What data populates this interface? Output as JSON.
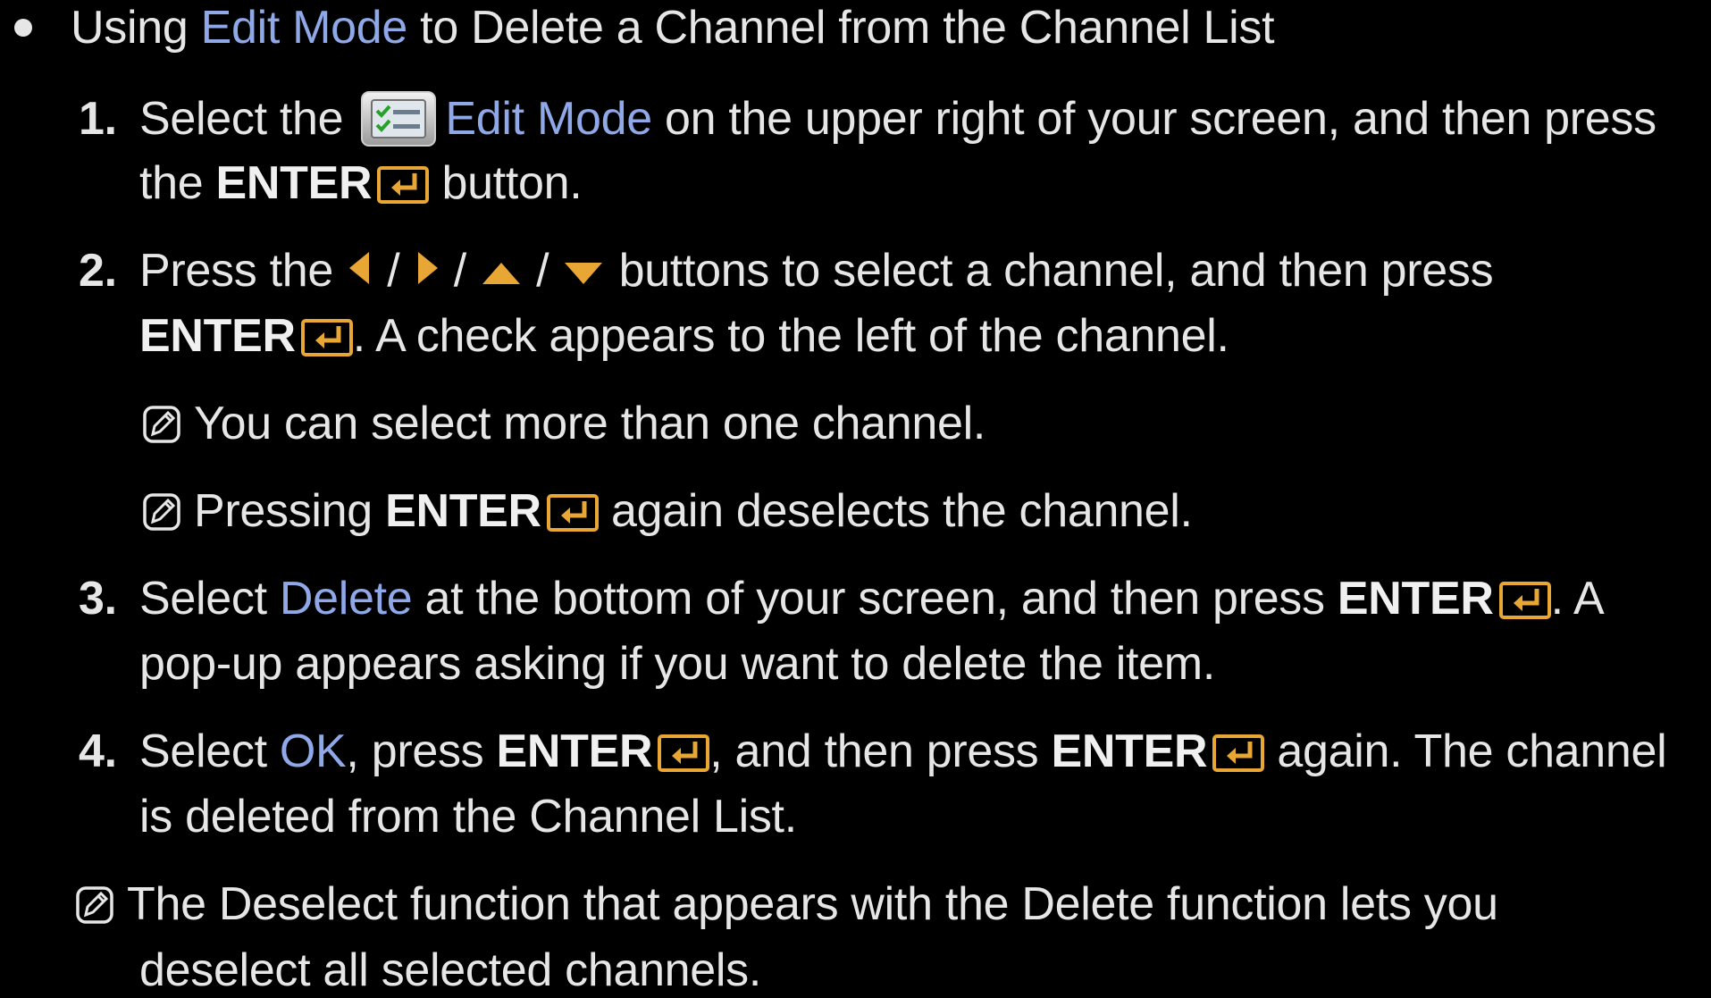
{
  "heading": {
    "prefix": "Using ",
    "highlight": "Edit Mode",
    "suffix": " to Delete a Channel from the Channel List"
  },
  "colors": {
    "text": "#e6e6e6",
    "highlight": "#8fa8e8",
    "icon_orange": "#e8a634"
  },
  "steps": {
    "s1": {
      "num": "1.",
      "a": "Select the ",
      "icon": "edit-mode-icon",
      "hl": "Edit Mode",
      "b": " on the upper right of your screen, and then press",
      "c": "the ",
      "enter": "ENTER",
      "d": " button."
    },
    "s2": {
      "num": "2.",
      "a": "Press the ",
      "sep": " / ",
      "b": " buttons to select a channel, and then press",
      "enter": "ENTER",
      "c": ". A check appears to the left of the channel."
    },
    "n1": {
      "text": "You can select more than one channel."
    },
    "n2": {
      "a": "Pressing ",
      "enter": "ENTER",
      "b": " again deselects the channel."
    },
    "s3": {
      "num": "3.",
      "a": "Select ",
      "hl": "Delete",
      "b": " at the bottom of your screen, and then press ",
      "enter": "ENTER",
      "c": ". A",
      "d": "pop-up appears asking if you want to delete the item."
    },
    "s4": {
      "num": "4.",
      "a": "Select ",
      "hl": "OK",
      "b": ", press ",
      "enter": "ENTER",
      "c": ", and then press ",
      "d": " again. The channel",
      "e": "is deleted from the Channel List."
    }
  },
  "final_note": {
    "a": "The Deselect function that appears with the Delete function lets you",
    "b": "deselect all selected channels."
  }
}
